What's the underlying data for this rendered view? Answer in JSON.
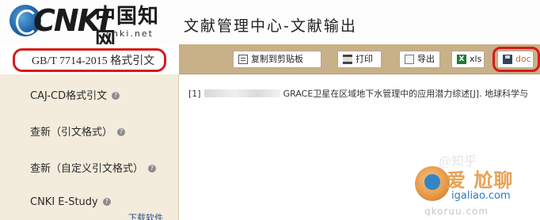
{
  "header": {
    "logo_latin": "CNKI",
    "logo_cn": "中国知网",
    "logo_url": "cnki.net",
    "title": "文献管理中心-文献输出"
  },
  "sidebar": {
    "items": [
      {
        "label": "GB/T 7714-2015 格式引文",
        "active": true
      },
      {
        "label": "CAJ-CD格式引文",
        "help": "?"
      },
      {
        "label": "查新（引文格式）",
        "help": "?"
      },
      {
        "label": "查新（自定义引文格式）",
        "help": "?"
      },
      {
        "label": "CNKI E-Study",
        "help": "?"
      }
    ],
    "download_link": "下载软件"
  },
  "toolbar": {
    "copy_label": "复制到剪贴板",
    "print_label": "打印",
    "export_label": "导出",
    "xls_label": "xls",
    "xls_icon": "X",
    "doc_label": "doc"
  },
  "content": {
    "citation_number": "[1]",
    "citation_text": "GRACE卫星在区域地下水管理中的应用潜力综述[J]. 地球科学与"
  },
  "watermark": {
    "ghost_text": "@知乎",
    "brand_cn": "爱 尬聊",
    "site": "igaliao.com",
    "faded": "qkoruu.com"
  },
  "colors": {
    "highlight_red": "#d61b1b",
    "toolbar_bg": "#c8b088",
    "sidebar_bg": "#f3ecdc",
    "doc_accent": "#c6652a"
  }
}
